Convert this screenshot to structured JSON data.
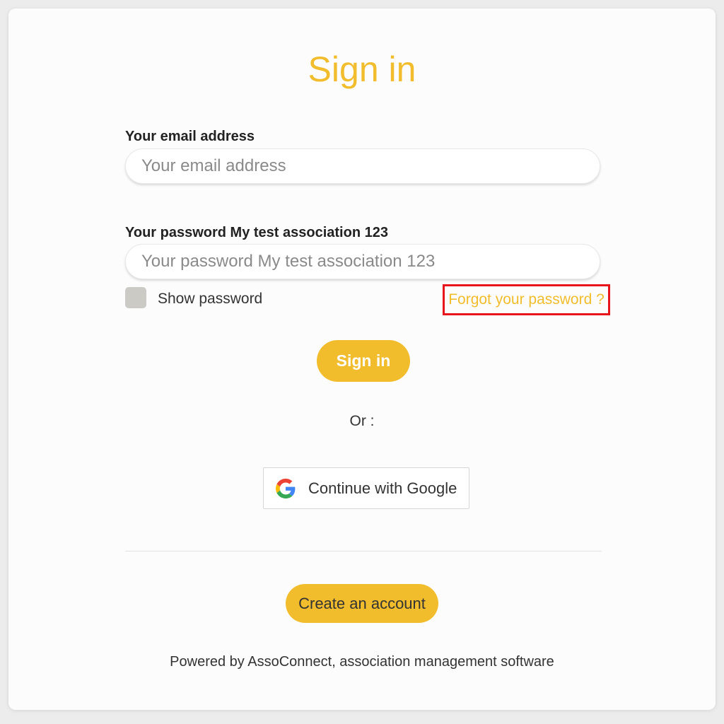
{
  "page": {
    "title": "Sign in"
  },
  "email": {
    "label": "Your email address",
    "placeholder": "Your email address",
    "value": ""
  },
  "password": {
    "label": "Your password My test association 123",
    "placeholder": "Your password My test association 123",
    "value": ""
  },
  "show_password": {
    "label": "Show password",
    "checked": false
  },
  "forgot_password": {
    "label": "Forgot your password ?"
  },
  "sign_in_button": {
    "label": "Sign in"
  },
  "separator": {
    "label": "Or :"
  },
  "google_button": {
    "label": "Continue with Google",
    "icon": "google-icon"
  },
  "create_account_button": {
    "label": "Create an account"
  },
  "footer": {
    "powered_by": "Powered by AssoConnect, association management software"
  },
  "colors": {
    "accent": "#f2bd2c",
    "highlight_border": "#e8141c",
    "text": "#333333",
    "checkbox": "#cbcac5"
  }
}
